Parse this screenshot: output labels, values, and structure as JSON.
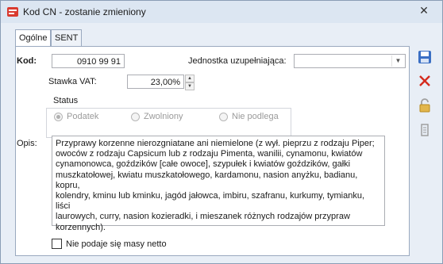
{
  "window": {
    "title": "Kod CN - zostanie zmieniony"
  },
  "tabs": [
    {
      "label": "Ogólne"
    },
    {
      "label": "SENT"
    }
  ],
  "form": {
    "kod_label": "Kod:",
    "kod_value": "0910 99 91",
    "jednostka_label": "Jednostka uzupełniająca:",
    "jednostka_value": "",
    "stawka_label": "Stawka VAT:",
    "stawka_value": "23,00%",
    "status_title": "Status",
    "status_options": [
      "Podatek",
      "Zwolniony",
      "Nie podlega"
    ],
    "status_selected": "Podatek",
    "opis_label": "Opis:",
    "opis_text": "Przyprawy korzenne nierozgniatane ani niemielone (z wył. pieprzu z rodzaju Piper;\nowoców z rodzaju Capsicum lub z rodzaju Pimenta, wanilii, cynamonu, kwiatów\ncynamonowca, goździków [całe owoce], szypułek i kwiatów goździków, gałki\nmuszkatołowej, kwiatu muszkatołowego, kardamonu, nasion anyżku, badianu, kopru,\nkolendry, kminu lub kminku, jagód jałowca, imbiru, szafranu, kurkumy, tymianku, liści\nlaurowych, curry, nasion kozieradki, i mieszanek różnych rodzajów przypraw\nkorzennych).",
    "masa_label": "Nie podaje się masy netto",
    "masa_checked": false
  },
  "sidebar_buttons": [
    {
      "icon": "save-icon"
    },
    {
      "icon": "delete-icon"
    },
    {
      "icon": "lock-icon"
    },
    {
      "icon": "attach-icon"
    }
  ]
}
